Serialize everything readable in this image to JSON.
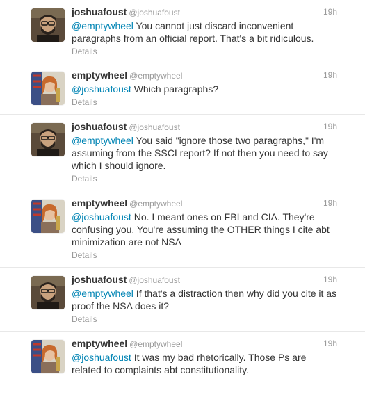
{
  "tweets": [
    {
      "fullname": "joshuafoust",
      "username": "@joshuafoust",
      "time": "19h",
      "mention": "@emptywheel",
      "text": " You cannot just discard inconvenient paragraphs from an official report. That's a bit ridiculous.",
      "details": "Details",
      "avatar": "joshuafoust-avatar"
    },
    {
      "fullname": "emptywheel",
      "username": "@emptywheel",
      "time": "19h",
      "mention": "@joshuafoust",
      "text": " Which paragraphs?",
      "details": "Details",
      "avatar": "emptywheel-avatar"
    },
    {
      "fullname": "joshuafoust",
      "username": "@joshuafoust",
      "time": "19h",
      "mention": "@emptywheel",
      "text": " You said \"ignore those two paragraphs,\" I'm assuming from the SSCI report? If not then you need to say which I should ignore.",
      "details": "Details",
      "avatar": "joshuafoust-avatar"
    },
    {
      "fullname": "emptywheel",
      "username": "@emptywheel",
      "time": "19h",
      "mention": "@joshuafoust",
      "text": " No. I meant ones on FBI and CIA. They're confusing you. You're assuming the OTHER things I cite abt minimization are not NSA",
      "details": "Details",
      "avatar": "emptywheel-avatar"
    },
    {
      "fullname": "joshuafoust",
      "username": "@joshuafoust",
      "time": "19h",
      "mention": "@emptywheel",
      "text": " If that's a distraction then why did you cite it as proof the NSA does it?",
      "details": "Details",
      "avatar": "joshuafoust-avatar"
    },
    {
      "fullname": "emptywheel",
      "username": "@emptywheel",
      "time": "19h",
      "mention": "@joshuafoust",
      "text": " It was my bad rhetorically. Those Ps are related to complaints abt constitutionality.",
      "details": "",
      "avatar": "emptywheel-avatar"
    }
  ],
  "colors": {
    "link": "#0084b4",
    "text": "#333333",
    "muted": "#999999",
    "divider": "#e8e8e8"
  }
}
